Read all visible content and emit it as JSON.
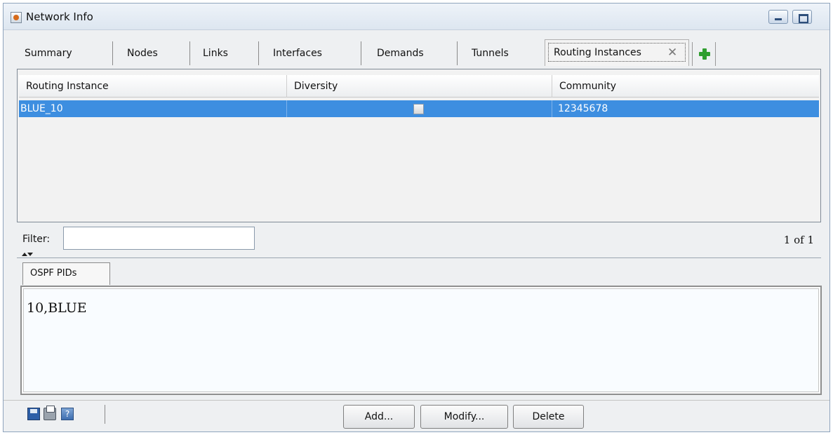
{
  "window": {
    "title": "Network Info"
  },
  "tabs": [
    {
      "label": "Summary"
    },
    {
      "label": "Nodes"
    },
    {
      "label": "Links"
    },
    {
      "label": "Interfaces"
    },
    {
      "label": "Demands"
    },
    {
      "label": "Tunnels"
    },
    {
      "label": "Routing Instances",
      "active": true
    }
  ],
  "tab_close_glyph": "✕",
  "table": {
    "columns": [
      "Routing Instance",
      "Diversity",
      "Community"
    ],
    "rows": [
      {
        "routing_instance": "BLUE_10",
        "diversity": false,
        "community": "12345678"
      }
    ]
  },
  "filter": {
    "label": "Filter:",
    "value": "",
    "count": "1 of 1"
  },
  "subtabs": [
    {
      "label": "OSPF PIDs"
    }
  ],
  "detail_text": "10,BLUE",
  "buttons": {
    "add": "Add...",
    "modify": "Modify...",
    "delete": "Delete"
  },
  "help_icon_glyph": "?",
  "colors": {
    "selection": "#3d8ee0",
    "add_icon": "#2f9e2f"
  }
}
